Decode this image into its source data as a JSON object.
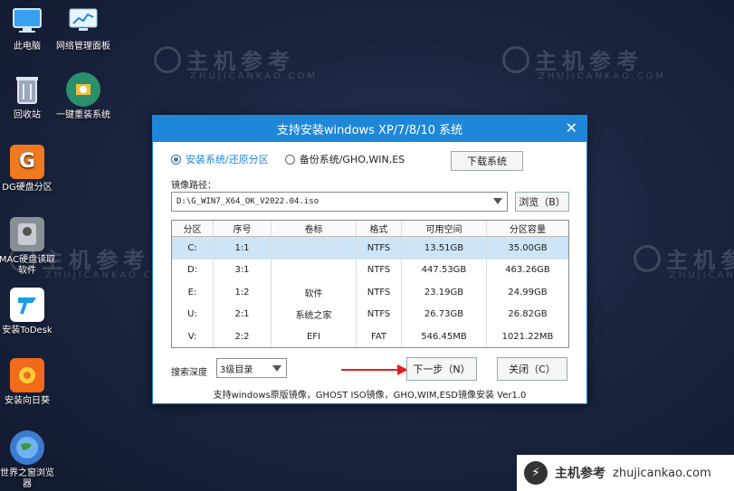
{
  "desktop": {
    "icons": [
      {
        "label": "此电脑",
        "icon": "computer-icon"
      },
      {
        "label": "网络管理面板",
        "icon": "network-panel-icon"
      },
      {
        "label": "回收站",
        "icon": "recycle-bin-icon"
      },
      {
        "label": "一键重装系统",
        "icon": "reinstall-icon"
      },
      {
        "label": "DG硬盘分区",
        "icon": "diskgenius-icon"
      },
      {
        "label": "MAC硬盘读取软件",
        "icon": "mac-disk-icon"
      },
      {
        "label": "安装ToDesk",
        "icon": "todesk-icon"
      },
      {
        "label": "安装向日葵",
        "icon": "sunflower-icon"
      },
      {
        "label": "世界之窗浏览器",
        "icon": "browser-icon"
      }
    ]
  },
  "watermark": {
    "cn": "主机参考",
    "en": "ZHUJICANKAO.COM"
  },
  "dialog": {
    "title": "支持安装windows XP/7/8/10 系统",
    "close": "✕",
    "radio_install": "安装系统/还原分区",
    "radio_backup": "备份系统/GHO,WIN,ES",
    "download_button": "下载系统",
    "image_path_label": "镜像路径：",
    "image_path_value": "D:\\G_WIN7_X64_OK_V2022.04.iso",
    "browse_button": "浏览（B）",
    "table": {
      "headers": [
        "分区",
        "序号",
        "卷标",
        "格式",
        "可用空间",
        "分区容量"
      ],
      "rows": [
        [
          "C:",
          "1:1",
          "",
          "NTFS",
          "13.51GB",
          "35.00GB"
        ],
        [
          "D:",
          "3:1",
          "",
          "NTFS",
          "447.53GB",
          "463.26GB"
        ],
        [
          "E:",
          "1:2",
          "软件",
          "NTFS",
          "23.19GB",
          "24.99GB"
        ],
        [
          "U:",
          "2:1",
          "系统之家",
          "NTFS",
          "26.73GB",
          "26.82GB"
        ],
        [
          "V:",
          "2:2",
          "EFI",
          "FAT",
          "546.45MB",
          "1021.22MB"
        ]
      ]
    },
    "search_depth_label": "搜索深度",
    "search_depth_value": "3级目录",
    "next_button": "下一步（N）",
    "close_button": "关闭（C）",
    "footer": "支持windows原版镜像，GHOST ISO镜像，GHO,WIM,ESD镜像安装 Ver1.0"
  },
  "banner": {
    "cn": "主机参考",
    "en": "zhujicankao.com"
  },
  "colors": {
    "accent": "#1e87d8",
    "arrow": "#e02020",
    "selected_row": "#cde5f7"
  }
}
